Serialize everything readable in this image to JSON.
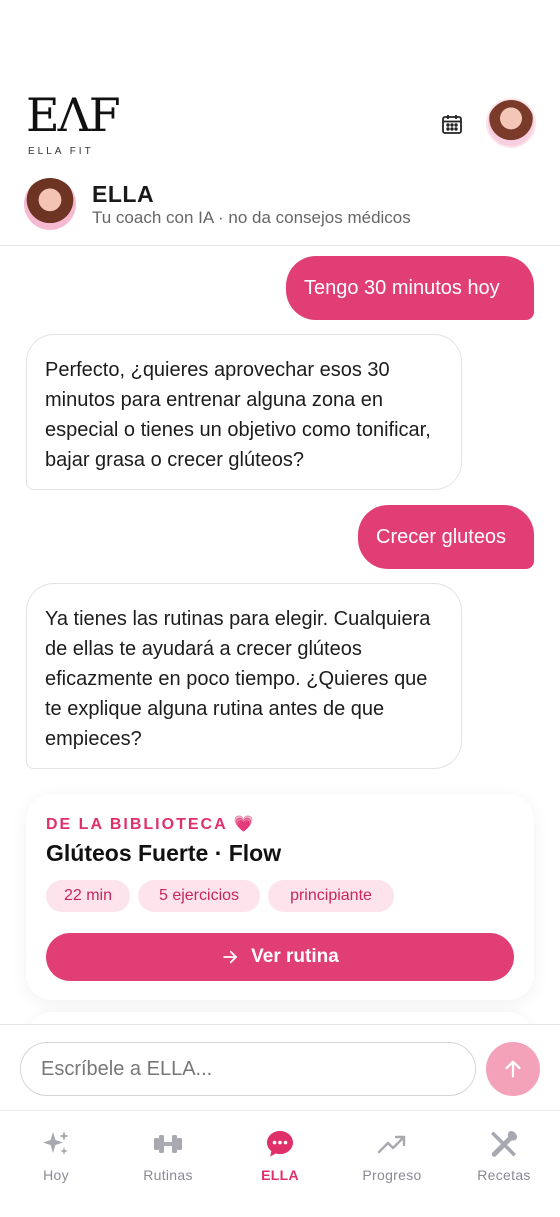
{
  "brand": {
    "mark": "EΛF",
    "name": "ELLA FIT"
  },
  "coach": {
    "name": "ELLA",
    "subtitle": "Tu coach con IA · no da consejos médicos"
  },
  "messages": [
    {
      "from": "user",
      "text": "Tengo 30 minutos hoy"
    },
    {
      "from": "bot",
      "text": "Perfecto, ¿quieres aprovechar esos 30 minutos para entrenar alguna zona en especial o tienes un objetivo como tonificar, bajar grasa o crecer glúteos?"
    },
    {
      "from": "user",
      "text": "Crecer gluteos"
    },
    {
      "from": "bot",
      "text": "Ya tienes las rutinas para elegir. Cualquiera de ellas te ayudará a crecer glúteos eficazmente en poco tiempo. ¿Quieres que te explique alguna rutina antes de que empieces?"
    }
  ],
  "routine_card": {
    "kicker": "DE LA BIBLIOTECA 💗",
    "title": "Glúteos Fuerte · Flow",
    "chips": [
      "22 min",
      "5 ejercicios",
      "principiante"
    ],
    "button_label": "Ver rutina"
  },
  "composer": {
    "placeholder": "Escríbele a ELLA..."
  },
  "tabs": [
    {
      "label": "Hoy",
      "icon": "sparkles-icon"
    },
    {
      "label": "Rutinas",
      "icon": "dumbbell-icon"
    },
    {
      "label": "ELLA",
      "icon": "chat-bubble-icon",
      "active": true
    },
    {
      "label": "Progreso",
      "icon": "trend-up-icon"
    },
    {
      "label": "Recetas",
      "icon": "utensils-icon"
    }
  ],
  "colors": {
    "accent": "#e23e76",
    "accent_soft": "#fde3ec",
    "inactive": "#8a8a92"
  }
}
